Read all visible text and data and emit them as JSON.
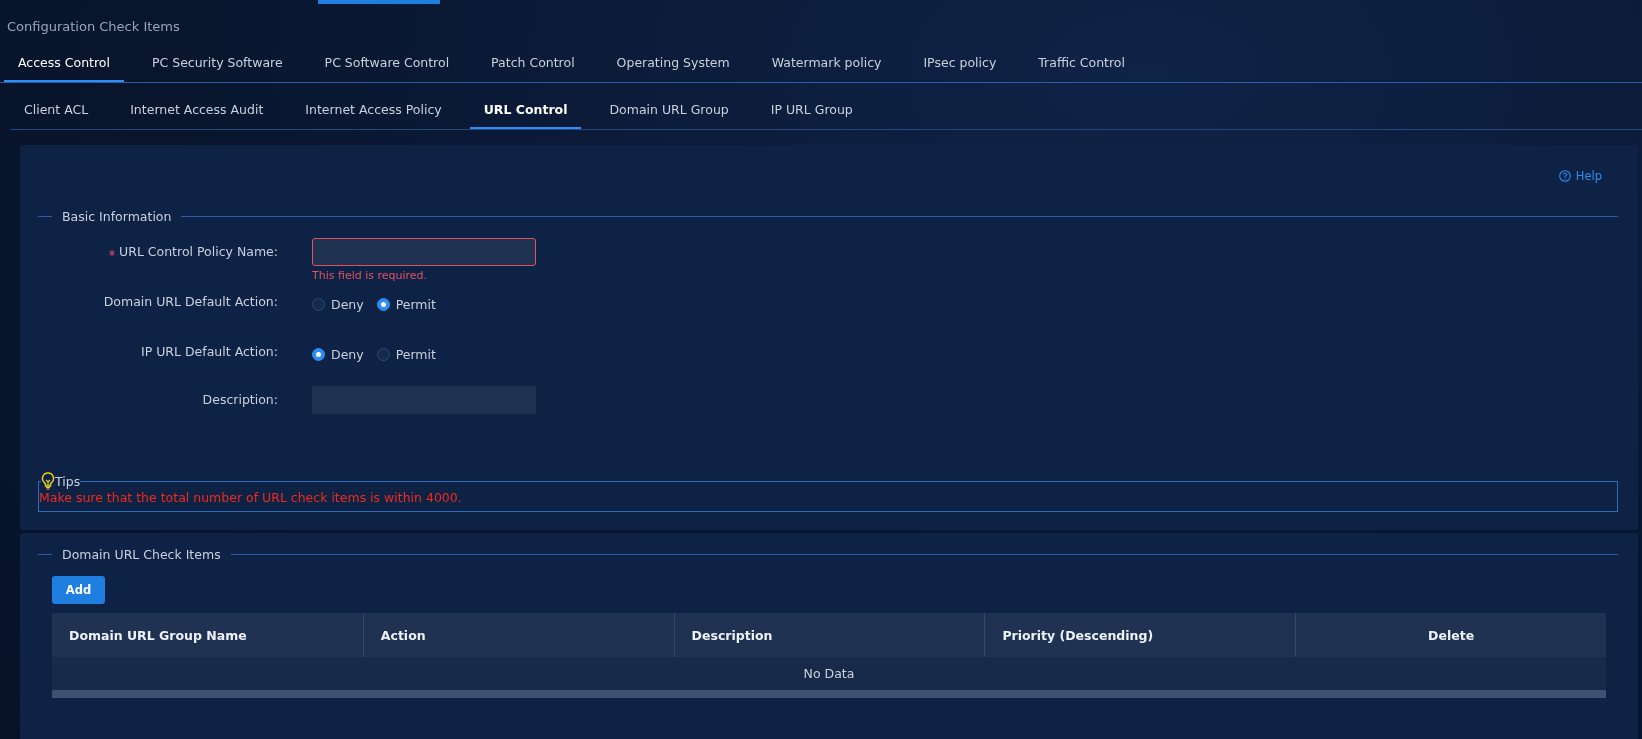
{
  "page_title": "Configuration Check Items",
  "tabs": [
    {
      "label": "Access Control",
      "selected": true
    },
    {
      "label": "PC Security Software",
      "selected": false
    },
    {
      "label": "PC Software Control",
      "selected": false
    },
    {
      "label": "Patch Control",
      "selected": false
    },
    {
      "label": "Operating System",
      "selected": false
    },
    {
      "label": "Watermark policy",
      "selected": false
    },
    {
      "label": "IPsec policy",
      "selected": false
    },
    {
      "label": "Traffic Control",
      "selected": false
    }
  ],
  "subtabs": [
    {
      "label": "Client ACL",
      "selected": false
    },
    {
      "label": "Internet Access Audit",
      "selected": false
    },
    {
      "label": "Internet Access Policy",
      "selected": false
    },
    {
      "label": "URL Control",
      "selected": true
    },
    {
      "label": "Domain URL Group",
      "selected": false
    },
    {
      "label": "IP URL Group",
      "selected": false
    }
  ],
  "help": "Help",
  "basic_information": {
    "title": "Basic Information",
    "fields": [
      {
        "kind": "text",
        "label": "URL Control Policy Name:",
        "required": true,
        "error": "This field is required."
      },
      {
        "kind": "radio",
        "label": "Domain URL Default Action:",
        "options": [
          {
            "label": "Deny",
            "selected": false
          },
          {
            "label": "Permit",
            "selected": true
          }
        ]
      },
      {
        "kind": "radio",
        "label": "IP URL Default Action:",
        "options": [
          {
            "label": "Deny",
            "selected": true
          },
          {
            "label": "Permit",
            "selected": false
          }
        ]
      },
      {
        "kind": "text",
        "label": "Description:",
        "required": false
      }
    ]
  },
  "tips": {
    "title": "Tips",
    "text": "Make sure that the total number of URL check items is within 4000."
  },
  "domain_url_check_items": {
    "title": "Domain URL Check Items",
    "add_button": "Add",
    "table": {
      "columns": [
        "Domain URL Group Name",
        "Action",
        "Description",
        "Priority (Descending)",
        "Delete"
      ],
      "empty_text": "No Data"
    }
  }
}
